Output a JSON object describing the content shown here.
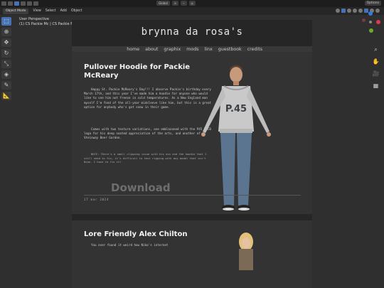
{
  "app": {
    "viewport_title": "User Perspective",
    "viewport_collection": "(1) CS Packie Mc | CS Packie Mc",
    "mode": "Object Mode",
    "menus": [
      "View",
      "Select",
      "Add",
      "Object"
    ],
    "transform_orientation": "Global",
    "options_label": "Options",
    "tools": [
      "select-box",
      "cursor",
      "move",
      "rotate",
      "scale",
      "transform",
      "annotate",
      "measure"
    ]
  },
  "site": {
    "title": "brynna da rosa's",
    "nav": [
      "home",
      "about",
      "graphix",
      "mods",
      "linx",
      "guestbook",
      "credits"
    ]
  },
  "post1": {
    "title": "Pullover Hoodie for Packie McReary",
    "p1": "Happy St. Packie McReary's Day!!! I observe Packie's birthday every March 17th, and this year I've made him a hoodie for anyone who would like to see him not freeze in cold temperatures. As a New England man myself I'm fond of the all-year midsleeve like him, but this is a great option for anybody who's got snow in their game.",
    "p2": "Comes with two texture variations, one emblazoned with the P45 NECB logo for his deep seated appreciation of the arts, and another of Steinway Beer Garden.",
    "note": "NOTE: There's a small clipping issue with his ass and the hoodie that I still need to fix, it's difficult to test rigging with any model that isn't Niko. I have to fix it!",
    "download": "Download",
    "date": "17 mar 2024",
    "hoodie_text": "P.45"
  },
  "post2": {
    "title": "Lore Friendly Alex Chilton",
    "p1": "You ever found it weird how Niko's internet"
  },
  "colors": {
    "accent": "#4772b3",
    "page_bg": "#262626",
    "card_bg": "#333333",
    "viewport_bg": "#2f2f2f"
  }
}
